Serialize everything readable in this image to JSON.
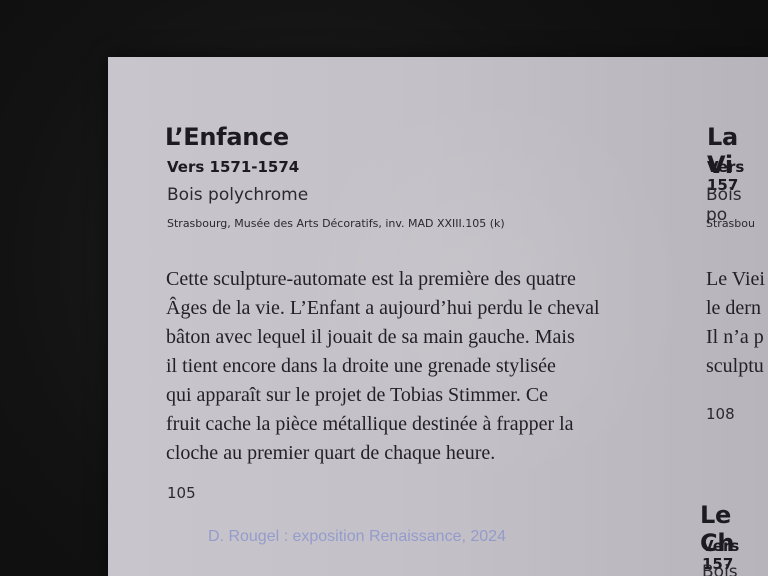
{
  "left_label": {
    "title": "L’Enfance",
    "date": "Vers 1571-1574",
    "material": "Bois polychrome",
    "location": "Strasbourg, Musée des Arts Décoratifs, inv. MAD XXIII.105 (k)",
    "body_lines": [
      "Cette sculpture-automate est la première des quatre",
      "Âges de la vie. L’Enfant a aujourd’hui perdu le cheval",
      "bâton avec lequel il jouait de sa main gauche. Mais",
      "il tient encore dans la droite une grenade stylisée",
      "qui apparaît sur le projet de Tobias Stimmer. Ce",
      "fruit cache la pièce métallique destinée à frapper la",
      "cloche au premier quart de chaque heure."
    ],
    "page_number": "105"
  },
  "right_label_top": {
    "title": "La Vi",
    "date": "Vers 157",
    "material": "Bois po",
    "location": "Strasbou",
    "body_lines": [
      "Le Viei",
      "le dern",
      "Il n’a p",
      "sculptu"
    ],
    "page_number": "108"
  },
  "right_label_bottom": {
    "title": "Le Ch",
    "date": "Vers 157",
    "material": "Bois pol"
  },
  "watermark": "D. Rougel : exposition Renaissance, 2024"
}
